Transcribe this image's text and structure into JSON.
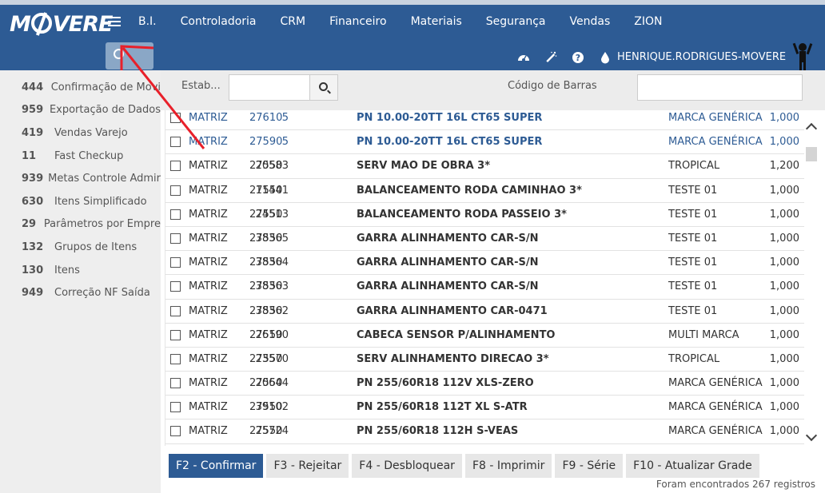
{
  "header": {
    "logo": "MOVERE",
    "menu": [
      "B.I.",
      "Controladoria",
      "CRM",
      "Financeiro",
      "Materiais",
      "Segurança",
      "Vendas",
      "ZION"
    ],
    "username": "HENRIQUE.RODRIGUES-MOVERE",
    "icons": [
      "dashboard-icon",
      "magic-wand-icon",
      "help-icon",
      "drop-icon"
    ]
  },
  "sidebar": {
    "items": [
      {
        "count": "444",
        "label": "Confirmação de Movi"
      },
      {
        "count": "959",
        "label": "Exportação de Dados"
      },
      {
        "count": "419",
        "label": "Vendas Varejo"
      },
      {
        "count": "11",
        "label": "Fast Checkup"
      },
      {
        "count": "939",
        "label": "Metas Controle Admir"
      },
      {
        "count": "630",
        "label": "Itens Simplificado"
      },
      {
        "count": "29",
        "label": "Parâmetros por Empre"
      },
      {
        "count": "132",
        "label": "Grupos de Itens"
      },
      {
        "count": "130",
        "label": "Itens"
      },
      {
        "count": "949",
        "label": "Correção NF Saída"
      }
    ]
  },
  "filters": {
    "estab_label": "Estab...",
    "estab_value": "",
    "barcode_label": "Código de Barras",
    "barcode_value": ""
  },
  "grid": {
    "rows": [
      {
        "estab": "MATRIZ",
        "doc": "27610",
        "code": "5",
        "desc": "PN 10.00-20TT 16L CT65 SUPER",
        "brand": "MARCA GENÉRICA",
        "qty": "1,000",
        "hl": true
      },
      {
        "estab": "MATRIZ",
        "doc": "27590",
        "code": "5",
        "desc": "PN 10.00-20TT 16L CT65 SUPER",
        "brand": "MARCA GENÉRICA",
        "qty": "1,000",
        "hl": true
      },
      {
        "estab": "MATRIZ",
        "doc": "27550",
        "code": "20583",
        "desc": "SERV MAO DE OBRA 3*",
        "brand": "TROPICAL",
        "qty": "1,200",
        "hl": false
      },
      {
        "estab": "MATRIZ",
        "doc": "27550",
        "code": "11441",
        "desc": "BALANCEAMENTO RODA CAMINHAO 3*",
        "brand": "TESTE 01",
        "qty": "1,000",
        "hl": false
      },
      {
        "estab": "MATRIZ",
        "doc": "27550",
        "code": "24513",
        "desc": "BALANCEAMENTO RODA PASSEIO 3*",
        "brand": "TESTE 01",
        "qty": "1,000",
        "hl": false
      },
      {
        "estab": "MATRIZ",
        "doc": "27550",
        "code": "38365",
        "desc": "GARRA ALINHAMENTO CAR-S/N",
        "brand": "TESTE 01",
        "qty": "1,000",
        "hl": false
      },
      {
        "estab": "MATRIZ",
        "doc": "27550",
        "code": "38364",
        "desc": "GARRA ALINHAMENTO CAR-S/N",
        "brand": "TESTE 01",
        "qty": "1,000",
        "hl": false
      },
      {
        "estab": "MATRIZ",
        "doc": "27550",
        "code": "38363",
        "desc": "GARRA ALINHAMENTO CAR-S/N",
        "brand": "TESTE 01",
        "qty": "1,000",
        "hl": false
      },
      {
        "estab": "MATRIZ",
        "doc": "27550",
        "code": "38362",
        "desc": "GARRA ALINHAMENTO CAR-0471",
        "brand": "TESTE 01",
        "qty": "1,000",
        "hl": false
      },
      {
        "estab": "MATRIZ",
        "doc": "27550",
        "code": "26190",
        "desc": "CABECA SENSOR P/ALINHAMENTO",
        "brand": "MULTI MARCA",
        "qty": "1,000",
        "hl": false
      },
      {
        "estab": "MATRIZ",
        "doc": "27550",
        "code": "23570",
        "desc": "SERV ALINHAMENTO DIRECAO 3*",
        "brand": "TROPICAL",
        "qty": "1,000",
        "hl": false
      },
      {
        "estab": "MATRIZ",
        "doc": "27550",
        "code": "20644",
        "desc": "PN 255/60R18 112V XLS-ZERO",
        "brand": "MARCA GENÉRICA",
        "qty": "1,000",
        "hl": false
      },
      {
        "estab": "MATRIZ",
        "doc": "27550",
        "code": "39102",
        "desc": "PN 255/60R18 112T XL S-ATR",
        "brand": "MARCA GENÉRICA",
        "qty": "1,000",
        "hl": false
      },
      {
        "estab": "MATRIZ",
        "doc": "27550",
        "code": "25724",
        "desc": "PN 255/60R18 112H S-VEAS",
        "brand": "MARCA GENÉRICA",
        "qty": "1,000",
        "hl": false
      }
    ]
  },
  "actions": [
    "F2 - Confirmar",
    "F3 - Rejeitar",
    "F4 - Desbloquear",
    "F8 - Imprimir",
    "F9 - Série",
    "F10 - Atualizar Grade"
  ],
  "records_text": "Foram encontrados 267 registros",
  "colors": {
    "primary": "#2d5b94",
    "annotation": "#e8202a"
  }
}
